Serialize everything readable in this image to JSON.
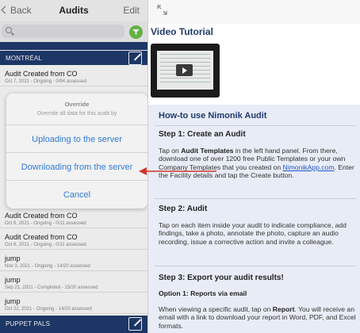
{
  "left": {
    "nav": {
      "back_label": "Back",
      "title": "Audits",
      "edit_label": "Edit"
    },
    "search": {
      "placeholder": ""
    },
    "sections": [
      {
        "label": "MONTRÉAL"
      },
      {
        "label": "PUPPET PALS"
      }
    ],
    "items": [
      {
        "title": "Audit Created from CO",
        "subtitle": "Oct 7, 2021 - Ongoing - 0/94 assessed"
      },
      {
        "title": "Audit Created from CO",
        "subtitle": "Oct 6, 2021 - Ongoing - 0/11 assessed"
      },
      {
        "title": "Audit Created from CO",
        "subtitle": "Oct 6, 2021 - Ongoing - 0/11 assessed"
      },
      {
        "title": "jump",
        "subtitle": "Nov 3, 2021 - Ongoing - 14/20 assessed"
      },
      {
        "title": "jump",
        "subtitle": "Sep 21, 2021 - Completed - 15/20 assessed"
      },
      {
        "title": "jump",
        "subtitle": "Oct 22, 2021 - Ongoing - 14/20 assessed"
      }
    ]
  },
  "popup": {
    "title": "Override",
    "message": "Override all data for this audit by",
    "uploading_label": "Uploading to the server",
    "downloading_label": "Downloading from the server",
    "cancel_label": "Cancel"
  },
  "right": {
    "video_title": "Video Tutorial",
    "howto_title": "How-to use Nimonik Audit",
    "step1_title": "Step 1: Create an Audit",
    "step1_text": {
      "a": "Tap on ",
      "b": "Audit Templates",
      "c": " in the left hand panel. From there, download one of over 1200 free Public Templates or your own Company Templates that you created on ",
      "link": "NimonikApp.com",
      "d": ". Enter the Facility details and tap the Create button."
    },
    "step2_title": "Step 2: Audit",
    "step2_text": "Tap on each item inside your audit to indicate compliance, add findings, take a photo, annotate the photo, capture an audio recording, issue a corrective action and invite a colleague.",
    "step3_title": "Step 3: Export your audit results!",
    "option1_title": "Option 1: Reports via email",
    "option1_text": {
      "a": "When viewing a specific audit, tap on ",
      "b": "Report",
      "c": ". You will receive an email with a link to download your report in Word, PDF, and Excel formats."
    }
  },
  "colors": {
    "section_bg": "#1f3b6e",
    "accent_blue": "#2f7cd6",
    "filter_green": "#6cc04a",
    "howto_bg": "#e8ecf6",
    "arrow_red": "#d0342c"
  },
  "icons": [
    "chevron-left-icon",
    "search-icon",
    "filter-icon",
    "edit-note-icon",
    "expand-icon",
    "play-icon",
    "arrow-left-icon"
  ]
}
